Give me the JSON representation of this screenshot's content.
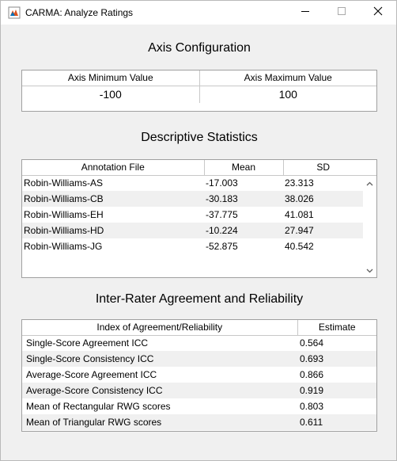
{
  "window": {
    "title": "CARMA: Analyze Ratings",
    "minimize_icon": "minimize-icon",
    "maximize_icon": "maximize-icon",
    "close_icon": "close-icon",
    "app_icon": "matlab-figure-icon"
  },
  "axis": {
    "title": "Axis Configuration",
    "headers": [
      "Axis Minimum Value",
      "Axis Maximum Value"
    ],
    "min_value": "-100",
    "max_value": "100"
  },
  "stats": {
    "title": "Descriptive Statistics",
    "headers": [
      "Annotation File",
      "Mean",
      "SD"
    ],
    "rows": [
      [
        "Robin-Williams-AS",
        "-17.003",
        "23.313"
      ],
      [
        "Robin-Williams-CB",
        "-30.183",
        "38.026"
      ],
      [
        "Robin-Williams-EH",
        "-37.775",
        "41.081"
      ],
      [
        "Robin-Williams-HD",
        "-10.224",
        "27.947"
      ],
      [
        "Robin-Williams-JG",
        "-52.875",
        "40.542"
      ]
    ]
  },
  "reliability": {
    "title": "Inter-Rater Agreement and Reliability",
    "headers": [
      "Index of Agreement/Reliability",
      "Estimate"
    ],
    "rows": [
      [
        "Single-Score Agreement ICC",
        "0.564"
      ],
      [
        "Single-Score Consistency ICC",
        "0.693"
      ],
      [
        "Average-Score Agreement ICC",
        "0.866"
      ],
      [
        "Average-Score Consistency ICC",
        "0.919"
      ],
      [
        "Mean of Rectangular RWG scores",
        "0.803"
      ],
      [
        "Mean of Triangular RWG scores",
        "0.611"
      ]
    ]
  }
}
